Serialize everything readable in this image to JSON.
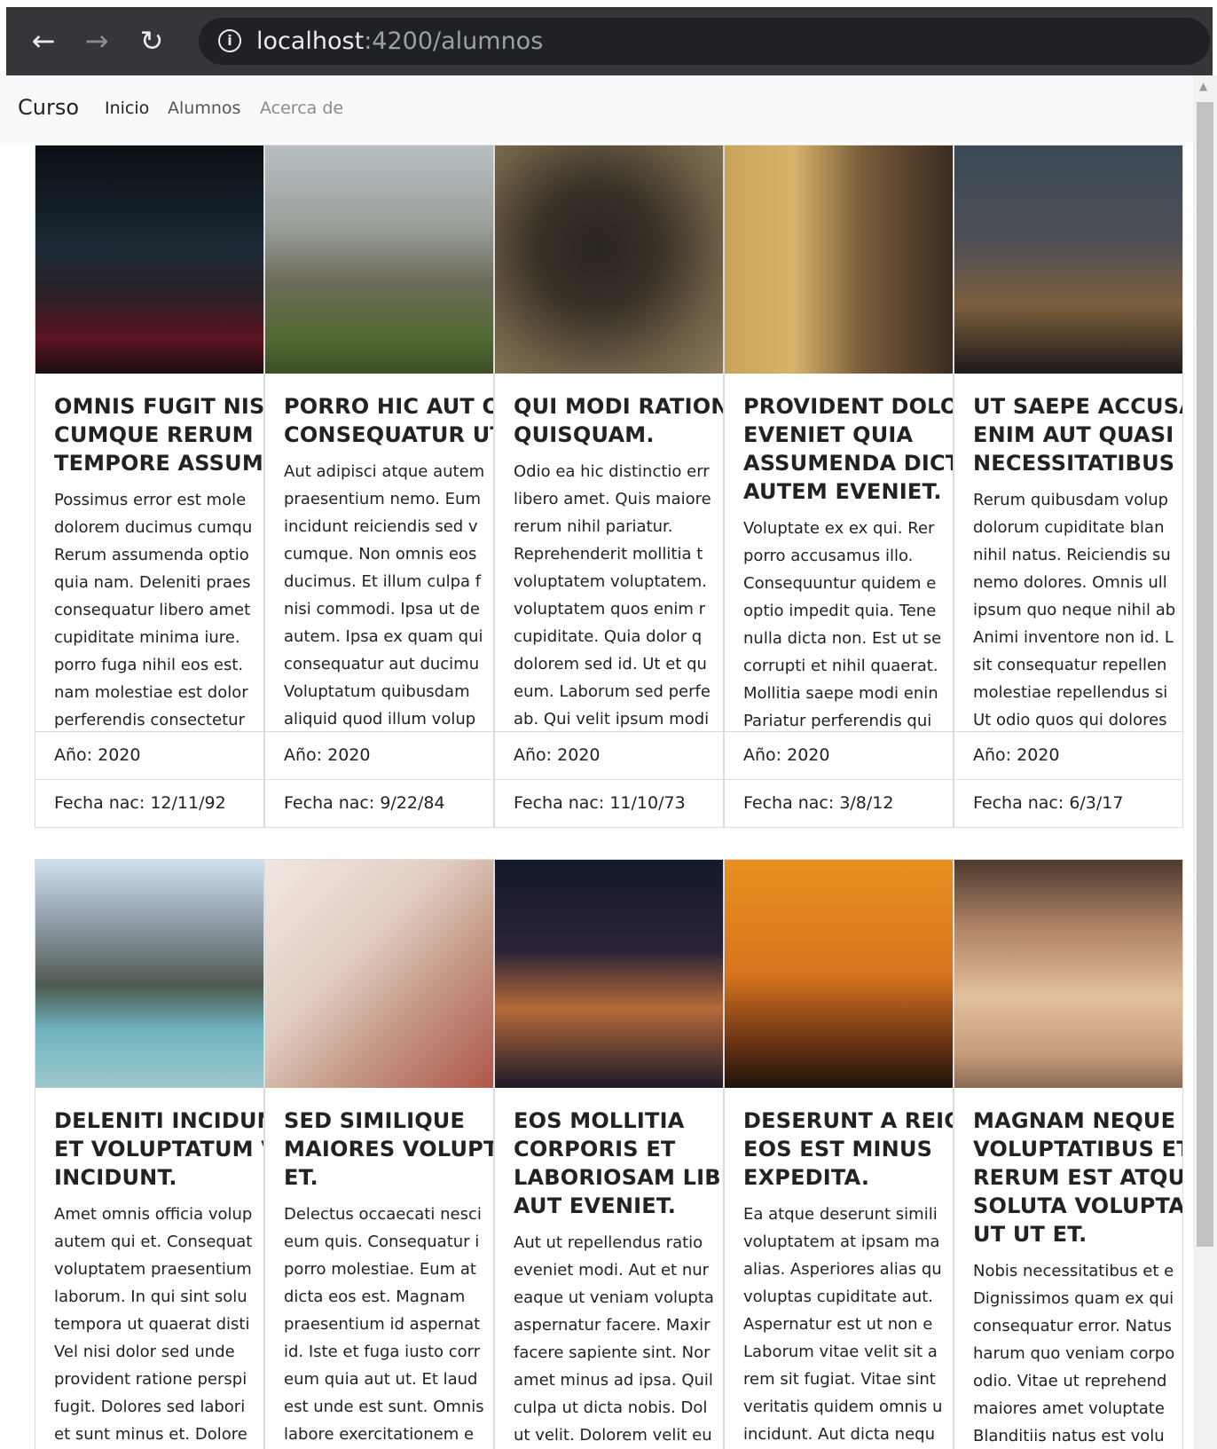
{
  "browser": {
    "url_host": "localhost",
    "url_path": ":4200/alumnos"
  },
  "navbar": {
    "brand": "Curso",
    "links": [
      {
        "label": "Inicio"
      },
      {
        "label": "Alumnos"
      },
      {
        "label": "Acerca de"
      }
    ]
  },
  "colors": {
    "browser_bg": "#35363a",
    "navbar_bg": "#f8f9fa",
    "inactive_link": "#8a8a8a"
  },
  "cards": [
    {
      "title": "OMNIS FUGIT NISI \nCUMQUE RERUM \nTEMPORE ASSUME",
      "text": "Possimus error est mole\ndolorem ducimus cumqu\nRerum assumenda optio\nquia nam. Deleniti praes\nconsequatur libero amet\ncupiditate minima iure. \nporro fuga nihil eos est.\nnam molestiae est dolor\nperferendis consectetur",
      "year": "Año: 2020",
      "birth": "Fecha nac: 12/11/92"
    },
    {
      "title": "PORRO HIC AUT O\nCONSEQUATUR UT",
      "text": "Aut adipisci atque autem\npraesentium nemo. Eum\nincidunt reiciendis sed v\ncumque. Non omnis eos\nducimus. Et illum culpa f\nnisi commodi. Ipsa ut de\nautem. Ipsa ex quam qui\nconsequatur aut ducimu\nVoluptatum quibusdam \naliquid quod illum volup",
      "year": "Año: 2020",
      "birth": "Fecha nac: 9/22/84"
    },
    {
      "title": "QUI MODI RATION\nQUISQUAM.",
      "text": "Odio ea hic distinctio err\nlibero amet. Quis maiore\nrerum nihil pariatur.\nReprehenderit mollitia t\nvoluptatem voluptatem.\nvoluptatem quos enim r\ncupiditate. Quia dolor q\ndolorem sed id. Ut et qu\neum. Laborum sed perfe\nab. Qui velit ipsum modi",
      "year": "Año: 2020",
      "birth": "Fecha nac: 11/10/73"
    },
    {
      "title": "PROVIDENT DOLO\nEVENIET QUIA\nASSUMENDA DICT\nAUTEM EVENIET.",
      "text": "Voluptate ex ex qui. Rer\nporro accusamus illo.\nConsequuntur quidem e\noptio impedit quia. Tene\nnulla dicta non. Est ut se\ncorrupti et nihil quaerat.\nMollitia saepe modi enin\nPariatur perferendis qui",
      "year": "Año: 2020",
      "birth": "Fecha nac: 3/8/12"
    },
    {
      "title": "UT SAEPE ACCUSA\nENIM AUT QUASI\nNECESSITATIBUS U",
      "text": "Rerum quibusdam volup\ndolorum cupiditate blan\nnihil natus. Reiciendis su\nnemo dolores. Omnis ull\nipsum quo neque nihil ab\nAnimi inventore non id. L\nsit consequatur repellen\nmolestiae repellendus si\nUt odio quos qui dolores",
      "year": "Año: 2020",
      "birth": "Fecha nac: 6/3/17"
    },
    {
      "title": "DELENITI INCIDUN\nET VOLUPTATUM V\nINCIDUNT.",
      "text": "Amet omnis officia volup\nautem qui et. Consequat\nvoluptatem praesentium\nlaborum. In qui sint solu\ntempora ut quaerat disti\nVel nisi dolor sed unde\nprovident ratione perspi\nfugit. Dolores sed labori\net sunt minus et. Dolore"
    },
    {
      "title": "SED SIMILIQUE\nMAIORES VOLUPTA\nET.",
      "text": "Delectus occaecati nesci\neum quis. Consequatur i\nporro molestiae. Eum at\ndicta eos est. Magnam\npraesentium id aspernat\nid. Iste et fuga iusto corr\neum quia aut ut. Et laud\nest unde est sunt. Omnis\nlabore exercitationem e"
    },
    {
      "title": "EOS MOLLITIA\nCORPORIS ET\nLABORIOSAM LIBE\nAUT EVENIET.",
      "text": "Aut ut repellendus ratio\neveniet modi. Aut et nur\neaque ut veniam volupta\naspernatur facere. Maxir\nfacere sapiente sint. Nor\namet minus ad ipsa. Quil\nculpa ut dicta nobis. Dol\nut velit. Dolorem velit eu"
    },
    {
      "title": "DESERUNT A REICI\nEOS EST MINUS\nEXPEDITA.",
      "text": "Ea atque deserunt simili\nvoluptatem at ipsam ma\nalias. Asperiores alias qu\nvoluptas cupiditate aut.\nAspernatur est ut non e\nLaborum vitae velit sit a\nrem sit fugiat. Vitae sint\nveritatis quidem omnis u\nincidunt. Aut dicta nequ"
    },
    {
      "title": "MAGNAM NEQUE\nVOLUPTATIBUS ET\nRERUM EST ATQUE\nSOLUTA VOLUPTAT\nUT UT ET.",
      "text": "Nobis necessitatibus et e\nDignissimos quam ex qui\nconsequatur error. Natus\nharum quo veniam corpo\nodio. Vitae ut reprehend\nmaiores amet voluptate\nBlanditiis natus est volu"
    }
  ]
}
